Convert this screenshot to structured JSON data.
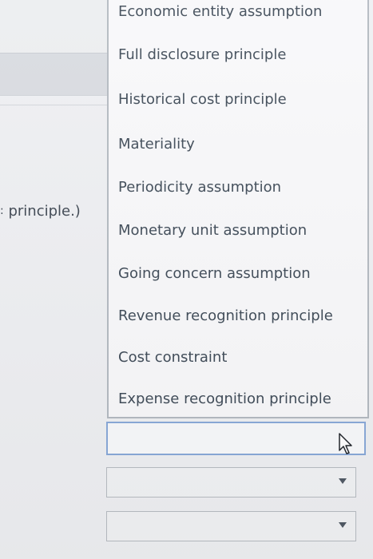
{
  "left_text": {
    "fragment": "principle.)"
  },
  "dropdown": {
    "items": [
      {
        "label": "Economic entity assumption"
      },
      {
        "label": "Full disclosure principle"
      },
      {
        "label": "Historical cost principle"
      },
      {
        "label": "Materiality"
      },
      {
        "label": "Periodicity assumption"
      },
      {
        "label": "Monetary unit assumption"
      },
      {
        "label": "Going concern assumption"
      },
      {
        "label": "Revenue recognition principle"
      },
      {
        "label": "Cost constraint"
      },
      {
        "label": "Expense recognition principle"
      }
    ]
  },
  "fields": {
    "active_value": "",
    "select_one_value": "",
    "select_two_value": ""
  },
  "icons": {
    "cursor": "mouse-pointer-icon",
    "arrow": "chevron-down-icon"
  }
}
